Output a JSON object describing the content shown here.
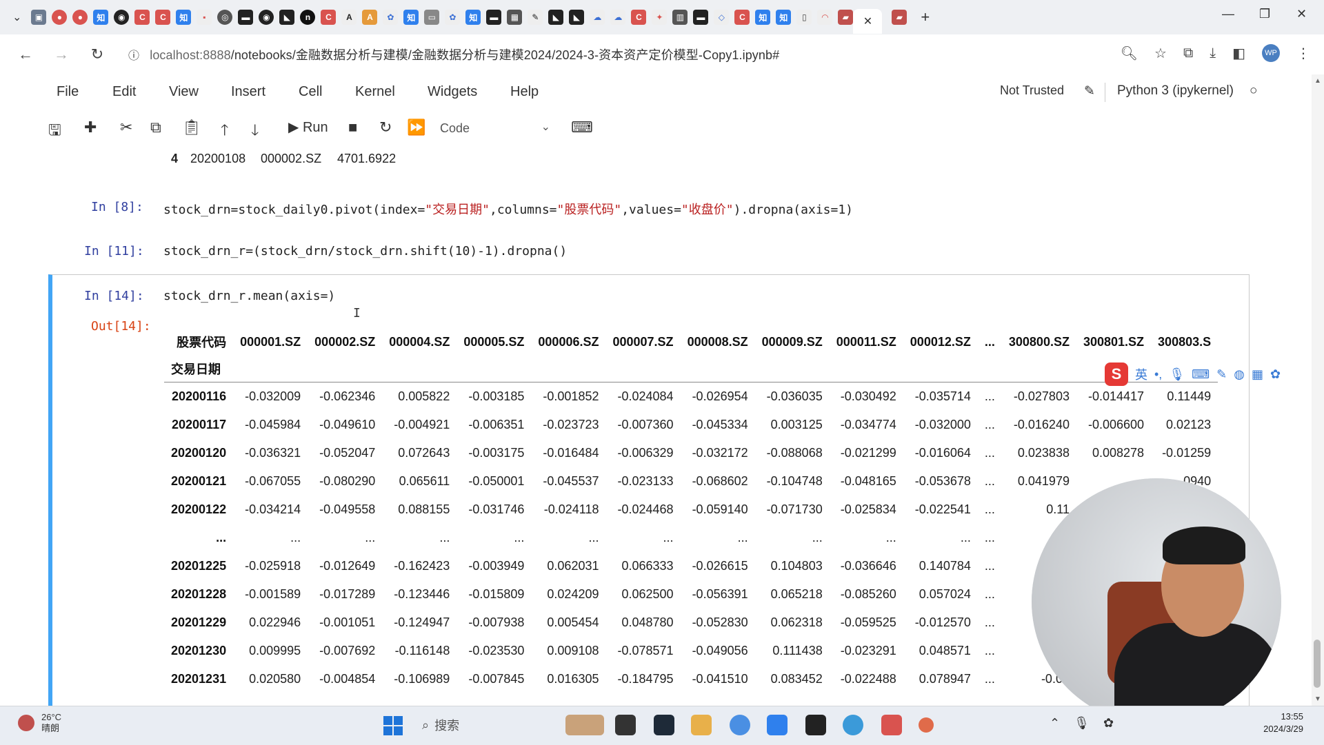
{
  "browser": {
    "tab_close": "✕",
    "new_tab": "+",
    "url_host": "localhost:8888",
    "url_path": "/notebooks/金融数据分析与建模/金融数据分析与建模2024/2024-3-资本资产定价模型-Copy1.ipynb#",
    "profile": "WP"
  },
  "menu": {
    "items": [
      "File",
      "Edit",
      "View",
      "Insert",
      "Cell",
      "Kernel",
      "Widgets",
      "Help"
    ],
    "trust": "Not Trusted",
    "kernel": "Python 3 (ipykernel)"
  },
  "toolbar": {
    "run_label": "Run",
    "cell_type": "Code"
  },
  "notebook": {
    "prev_output_row": [
      "4",
      "20200108",
      "000002.SZ",
      "4701.6922"
    ],
    "cells": [
      {
        "prompt": "In  [8]:",
        "code_pre": "stock_drn=stock_daily0.pivot(index=",
        "s1": "\"交易日期\"",
        "mid1": ",columns=",
        "s2": "\"股票代码\"",
        "mid2": ",values=",
        "s3": "\"收盘价\"",
        "post": ").dropna(axis=1)"
      },
      {
        "prompt": "In [11]:",
        "code": "stock_drn_r=(stock_drn/stock_drn.shift(10)-1).dropna()"
      },
      {
        "prompt": "In [14]:",
        "code": "stock_drn_r.mean(axis=)"
      }
    ],
    "out_prompt": "Out[14]:"
  },
  "dataframe": {
    "columns_name": "股票代码",
    "index_name": "交易日期",
    "columns": [
      "000001.SZ",
      "000002.SZ",
      "000004.SZ",
      "000005.SZ",
      "000006.SZ",
      "000007.SZ",
      "000008.SZ",
      "000009.SZ",
      "000011.SZ",
      "000012.SZ",
      "...",
      "300800.SZ",
      "300801.SZ",
      "300803.S"
    ],
    "rows": [
      {
        "index": "20200116",
        "values": [
          "-0.032009",
          "-0.062346",
          "0.005822",
          "-0.003185",
          "-0.001852",
          "-0.024084",
          "-0.026954",
          "-0.036035",
          "-0.030492",
          "-0.035714",
          "...",
          "-0.027803",
          "-0.014417",
          "0.11449"
        ]
      },
      {
        "index": "20200117",
        "values": [
          "-0.045984",
          "-0.049610",
          "-0.004921",
          "-0.006351",
          "-0.023723",
          "-0.007360",
          "-0.045334",
          "0.003125",
          "-0.034774",
          "-0.032000",
          "...",
          "-0.016240",
          "-0.006600",
          "0.02123"
        ]
      },
      {
        "index": "20200120",
        "values": [
          "-0.036321",
          "-0.052047",
          "0.072643",
          "-0.003175",
          "-0.016484",
          "-0.006329",
          "-0.032172",
          "-0.088068",
          "-0.021299",
          "-0.016064",
          "...",
          "0.023838",
          "0.008278",
          "-0.01259"
        ]
      },
      {
        "index": "20200121",
        "values": [
          "-0.067055",
          "-0.080290",
          "0.065611",
          "-0.050001",
          "-0.045537",
          "-0.023133",
          "-0.068602",
          "-0.104748",
          "-0.048165",
          "-0.053678",
          "...",
          "0.041979",
          "",
          "0940"
        ]
      },
      {
        "index": "20200122",
        "values": [
          "-0.034214",
          "-0.049558",
          "0.088155",
          "-0.031746",
          "-0.024118",
          "-0.024468",
          "-0.059140",
          "-0.071730",
          "-0.025834",
          "-0.022541",
          "...",
          "0.11",
          "",
          ""
        ]
      },
      {
        "index": "...",
        "values": [
          "...",
          "...",
          "...",
          "...",
          "...",
          "...",
          "...",
          "...",
          "...",
          "...",
          "...",
          "",
          "",
          ""
        ]
      },
      {
        "index": "20201225",
        "values": [
          "-0.025918",
          "-0.012649",
          "-0.162423",
          "-0.003949",
          "0.062031",
          "0.066333",
          "-0.026615",
          "0.104803",
          "-0.036646",
          "0.140784",
          "...",
          "",
          "",
          ""
        ]
      },
      {
        "index": "20201228",
        "values": [
          "-0.001589",
          "-0.017289",
          "-0.123446",
          "-0.015809",
          "0.024209",
          "0.062500",
          "-0.056391",
          "0.065218",
          "-0.085260",
          "0.057024",
          "...",
          "",
          "",
          ""
        ]
      },
      {
        "index": "20201229",
        "values": [
          "0.022946",
          "-0.001051",
          "-0.124947",
          "-0.007938",
          "0.005454",
          "0.048780",
          "-0.052830",
          "0.062318",
          "-0.059525",
          "-0.012570",
          "...",
          "",
          "",
          ""
        ]
      },
      {
        "index": "20201230",
        "values": [
          "0.009995",
          "-0.007692",
          "-0.116148",
          "-0.023530",
          "0.009108",
          "-0.078571",
          "-0.049056",
          "0.111438",
          "-0.023291",
          "0.048571",
          "...",
          "-0.",
          "",
          ""
        ]
      },
      {
        "index": "20201231",
        "values": [
          "0.020580",
          "-0.004854",
          "-0.106989",
          "-0.007845",
          "0.016305",
          "-0.184795",
          "-0.041510",
          "0.083452",
          "-0.022488",
          "0.078947",
          "...",
          "-0.04",
          "",
          ""
        ]
      }
    ]
  },
  "ime": {
    "logo": "S",
    "lang": "英"
  },
  "taskbar": {
    "weather_temp": "26°C",
    "weather_desc": "晴朗",
    "search_placeholder": "搜索",
    "time": "13:55",
    "date": "2024/3/29"
  },
  "colors": {
    "accent": "#42a5f5",
    "prompt_in": "#303f9f",
    "prompt_out": "#d84315",
    "string": "#ba2121"
  }
}
